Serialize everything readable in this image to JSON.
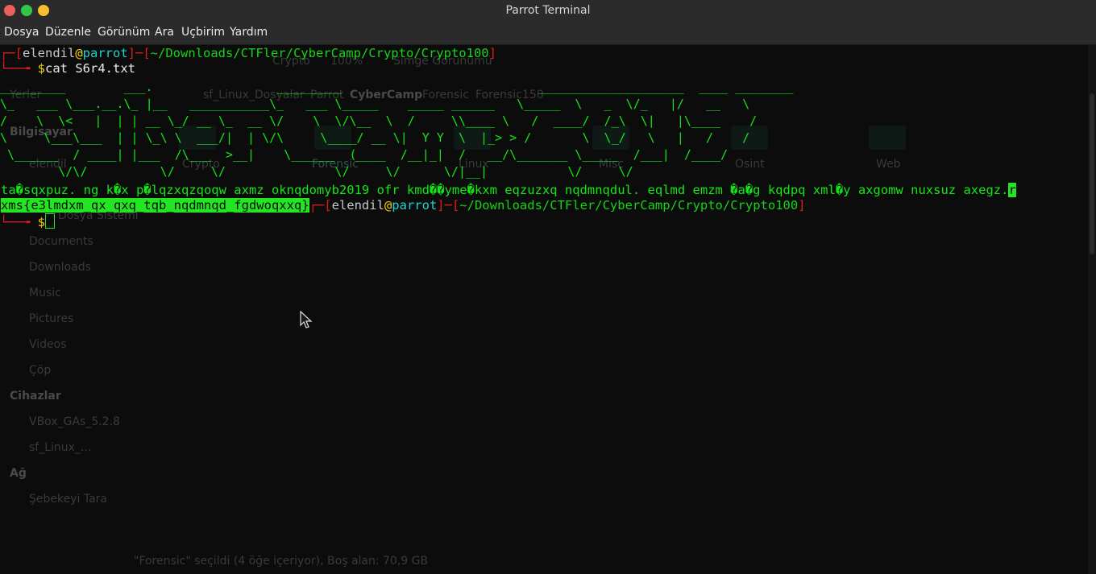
{
  "window": {
    "title": "Parrot Terminal"
  },
  "menu": [
    "Dosya",
    "Düzenle",
    "Görünüm",
    "Ara",
    "Uçbirim",
    "Yardım"
  ],
  "prompt": {
    "user": "elendil",
    "at": "@",
    "host": "parrot",
    "path": "~/Downloads/CTFler/CyberCamp/Crypto/Crypto100",
    "symbol": "$"
  },
  "command": "cat S6r4.txt",
  "banner": [
    "_________        ___.                 _________                           ____________________  ____ ________",
    "\\_   ___ \\___.__.\\_ |__   ___________\\_   ___ \\_____    _____ ______   \\_____  \\   _  \\/_   |/   __   \\",
    "/    \\  \\<   |  | | __ \\_/ __ \\_  __ \\/    \\  \\/\\__  \\  /     \\\\____ \\   /  ____/  /_\\  \\|   |\\____    /",
    "\\     \\___\\___  | | \\_\\ \\  ___/|  | \\/\\     \\____/ __ \\|  Y Y  \\  |_> > /       \\  \\_/   \\   |   /    /",
    " \\______  / ____| |___  /\\___  >__|    \\______  (____  /__|_|  /   __/\\_______ \\_____  /___|  /____/",
    "        \\/\\/          \\/     \\/               \\/     \\/      \\/|__|           \\/     \\/"
  ],
  "ciphertext": "ta�sqxpuz. ng k�x p�lqzxqzqoqw axmz oknqdomyb2019 ofr kmd��yme�kxm eqzuzxq nqdmnqdul. eqlmd emzm �a�g kqdpq xml�y axgomw nuxsuz axegz.",
  "ciphertext_tail": "r",
  "flag": "xms{e3lmdxm_qx_qxq_tqb_nqdmnqd_fgdwoqxxq}",
  "ghost": {
    "toolbar": [
      "Crypto",
      "100%",
      "Simge Görünümü"
    ],
    "path_tabs": [
      "sf_Linux_Dosyalar",
      "Parrot",
      "CyberCamp",
      "Forensic",
      "Forensic150"
    ],
    "sidebar_places": [
      "Yerler",
      "Bilgisayar",
      "elendil"
    ],
    "sidebar_items": [
      "Documents",
      "Downloads",
      "Music",
      "Pictures",
      "Videos",
      "Çöp"
    ],
    "sidebar_system": "Dosya Sistemi",
    "devices_header": "Cihazlar",
    "devices": [
      "VBox_GAs_5.2.8",
      "sf_Linux_..."
    ],
    "network_header": "Ağ",
    "network_item": "Şebekeyi Tara",
    "folders": [
      "Crypto",
      "Forensic",
      "Linux",
      "Misc",
      "Osint",
      "Web"
    ],
    "status": "\"Forensic\" seçildi (4 öğe içeriyor), Boş alan: 70,9 GB"
  }
}
